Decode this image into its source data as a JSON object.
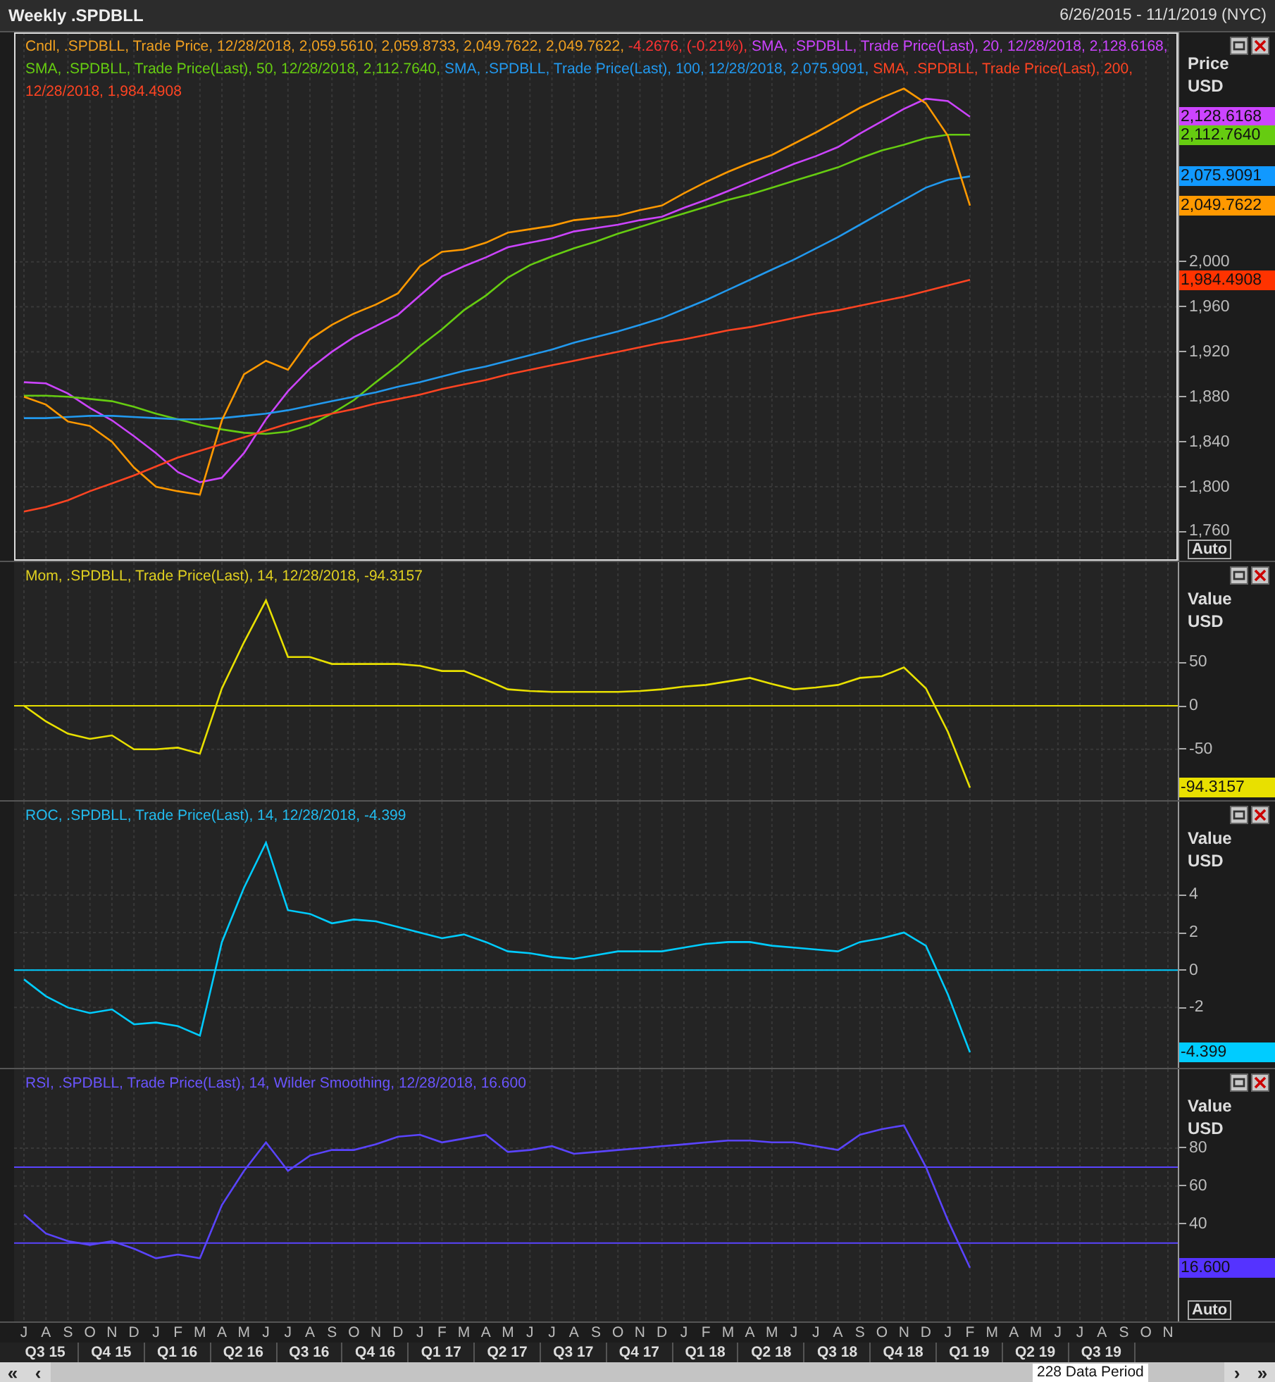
{
  "header": {
    "title": "Weekly .SPDBLL",
    "range": "6/26/2015 - 11/1/2019 (NYC)"
  },
  "panels": [
    {
      "axis_title": "Price",
      "axis_unit": "USD",
      "auto": "Auto",
      "legend": [
        {
          "text": "Cndl, .SPDBLL, Trade Price, 12/28/2018, 2,059.5610, 2,059.8733, 2,049.7622, 2,049.7622,",
          "color": "#f0a020"
        },
        {
          "text": " -4.2676, (-0.21%),",
          "color": "#ff3333"
        },
        {
          "text": " SMA, .SPDBLL, Trade Price(Last), 20, 12/28/2018, 2,128.6168,",
          "color": "#cc44ff"
        },
        {
          "text": " SMA, .SPDBLL, Trade Price(Last), 50, 12/28/2018, 2,112.7640,",
          "color": "#66cc11"
        },
        {
          "text": " SMA, .SPDBLL, Trade Price(Last), 100, 12/28/2018, 2,075.9091,",
          "color": "#2299ee"
        },
        {
          "text": " SMA, .SPDBLL, Trade Price(Last), 200, 12/28/2018, 1,984.4908",
          "color": "#ff4422"
        }
      ],
      "tags": [
        {
          "text": "2,128.6168",
          "color": "#cc44ff"
        },
        {
          "text": "2,112.7640",
          "color": "#66cc11"
        },
        {
          "text": "2,075.9091",
          "color": "#1199ff"
        },
        {
          "text": "2,049.7622",
          "color": "#ff9900"
        },
        {
          "text": "1,984.4908",
          "color": "#ff3300"
        }
      ],
      "chart_data": {
        "type": "line",
        "ylim": [
          1733,
          2204
        ],
        "categories": [
          null,
          null,
          null,
          null,
          null,
          null,
          null,
          null,
          null,
          null,
          null,
          null,
          null,
          null,
          null,
          null,
          null,
          null,
          null,
          null,
          null,
          null,
          null,
          null,
          null,
          null,
          null,
          null,
          null,
          null,
          null,
          null,
          null,
          null,
          null,
          null,
          null,
          null,
          null,
          null,
          null,
          null,
          null,
          null,
          null,
          null,
          null,
          null,
          null,
          null,
          null,
          null,
          null
        ],
        "yticks": [
          {
            "value": 1760,
            "label": "1,760"
          },
          {
            "value": 1800,
            "label": "1,800"
          },
          {
            "value": 1840,
            "label": "1,840"
          },
          {
            "value": 1880,
            "label": "1,880"
          },
          {
            "value": 1920,
            "label": "1,920"
          },
          {
            "value": 1960,
            "label": "1,960"
          },
          {
            "value": 2000,
            "label": "2,000"
          }
        ],
        "grid": true,
        "series": [
          {
            "color": "#cc44ff",
            "values": [
              1893,
              1892,
              1883,
              1870,
              1859,
              1845,
              1830,
              1813,
              1804,
              1808,
              1830,
              1860,
              1885,
              1905,
              1920,
              1933,
              1943,
              1953,
              1970,
              1987,
              1996,
              2004,
              2013,
              2017,
              2021,
              2027,
              2030,
              2033,
              2037,
              2040,
              2048,
              2055,
              2063,
              2071,
              2079,
              2087,
              2094,
              2102,
              2114,
              2125,
              2136,
              2145,
              2143,
              2129,
              null,
              null,
              null,
              null,
              null,
              null,
              null,
              null,
              null
            ]
          },
          {
            "color": "#66cc11",
            "values": [
              1881,
              1881,
              1880,
              1878,
              1876,
              1871,
              1865,
              1860,
              1855,
              1851,
              1848,
              1847,
              1849,
              1855,
              1865,
              1877,
              1893,
              1908,
              1925,
              1940,
              1957,
              1970,
              1986,
              1997,
              2005,
              2012,
              2018,
              2025,
              2031,
              2037,
              2043,
              2049,
              2055,
              2060,
              2066,
              2072,
              2078,
              2084,
              2092,
              2099,
              2104,
              2110,
              2113,
              2113,
              null,
              null,
              null,
              null,
              null,
              null,
              null,
              null,
              null
            ]
          },
          {
            "color": "#2299ee",
            "values": [
              1861,
              1861,
              1862,
              1863,
              1863,
              1862,
              1861,
              1860,
              1860,
              1861,
              1863,
              1865,
              1868,
              1872,
              1876,
              1880,
              1884,
              1889,
              1893,
              1898,
              1903,
              1907,
              1912,
              1917,
              1922,
              1928,
              1933,
              1938,
              1944,
              1950,
              1958,
              1966,
              1975,
              1984,
              1993,
              2002,
              2012,
              2022,
              2033,
              2044,
              2055,
              2066,
              2073,
              2076,
              null,
              null,
              null,
              null,
              null,
              null,
              null,
              null,
              null
            ]
          },
          {
            "color": "#ff9900",
            "values": [
              1880,
              1873,
              1858,
              1854,
              1840,
              1817,
              1800,
              1796,
              1793,
              1859,
              1900,
              1912,
              1904,
              1931,
              1944,
              1954,
              1962,
              1972,
              1996,
              2009,
              2011,
              2017,
              2026,
              2029,
              2032,
              2037,
              2039,
              2041,
              2046,
              2050,
              2061,
              2071,
              2080,
              2088,
              2095,
              2105,
              2115,
              2126,
              2137,
              2146,
              2154,
              2141,
              2112,
              2050,
              null,
              null,
              null,
              null,
              null,
              null,
              null,
              null,
              null
            ]
          },
          {
            "color": "#ff4422",
            "values": [
              1778,
              1782,
              1788,
              1796,
              1803,
              1810,
              1818,
              1826,
              1832,
              1838,
              1844,
              1850,
              1856,
              1861,
              1865,
              1869,
              1874,
              1878,
              1882,
              1887,
              1891,
              1895,
              1900,
              1904,
              1908,
              1912,
              1916,
              1920,
              1924,
              1928,
              1931,
              1935,
              1939,
              1942,
              1946,
              1950,
              1954,
              1957,
              1961,
              1965,
              1969,
              1974,
              1979,
              1984,
              null,
              null,
              null,
              null,
              null,
              null,
              null,
              null,
              null
            ]
          }
        ]
      }
    },
    {
      "axis_title": "Value",
      "axis_unit": "USD",
      "legend": [
        {
          "text": "Mom, .SPDBLL, Trade Price(Last), 14, 12/28/2018, -94.3157",
          "color": "#e0d020"
        }
      ],
      "tags": [
        {
          "text": "-94.3157",
          "color": "#e8e000"
        }
      ],
      "chart_data": {
        "type": "line",
        "ylim": [
          -110,
          165
        ],
        "categories": [
          null,
          null,
          null,
          null,
          null,
          null,
          null,
          null,
          null,
          null,
          null,
          null,
          null,
          null,
          null,
          null,
          null,
          null,
          null,
          null,
          null,
          null,
          null,
          null,
          null,
          null,
          null,
          null,
          null,
          null,
          null,
          null,
          null,
          null,
          null,
          null,
          null,
          null,
          null,
          null,
          null,
          null,
          null,
          null,
          null,
          null,
          null,
          null,
          null,
          null,
          null,
          null,
          null
        ],
        "yticks": [
          {
            "value": 50,
            "label": "50"
          },
          {
            "value": 0,
            "label": "0"
          },
          {
            "value": -50,
            "label": "-50"
          }
        ],
        "ref_lines": [
          {
            "axis": "y",
            "value": 0
          }
        ],
        "grid": true,
        "series": [
          {
            "color": "#e8e000",
            "values": [
              0,
              -18,
              -32,
              -38,
              -34,
              -50,
              -50,
              -48,
              -55,
              20,
              73,
              121,
              56,
              56,
              48,
              48,
              48,
              48,
              46,
              40,
              40,
              30,
              19,
              17,
              16,
              16,
              16,
              16,
              17,
              19,
              22,
              24,
              28,
              32,
              25,
              19,
              21,
              24,
              32,
              34,
              44,
              20,
              -30,
              -94,
              null,
              null,
              null,
              null,
              null,
              null,
              null,
              null,
              null
            ]
          }
        ]
      }
    },
    {
      "axis_title": "Value",
      "axis_unit": "USD",
      "legend": [
        {
          "text": "ROC, .SPDBLL, Trade Price(Last), 14, 12/28/2018, -4.399",
          "color": "#22bbee"
        }
      ],
      "tags": [
        {
          "text": "-4.399",
          "color": "#00ccff"
        }
      ],
      "chart_data": {
        "type": "line",
        "ylim": [
          -5.3,
          9
        ],
        "categories": [
          null,
          null,
          null,
          null,
          null,
          null,
          null,
          null,
          null,
          null,
          null,
          null,
          null,
          null,
          null,
          null,
          null,
          null,
          null,
          null,
          null,
          null,
          null,
          null,
          null,
          null,
          null,
          null,
          null,
          null,
          null,
          null,
          null,
          null,
          null,
          null,
          null,
          null,
          null,
          null,
          null,
          null,
          null,
          null,
          null,
          null,
          null,
          null,
          null,
          null,
          null,
          null,
          null
        ],
        "yticks": [
          {
            "value": 4,
            "label": "4"
          },
          {
            "value": 2,
            "label": "2"
          },
          {
            "value": 0,
            "label": "0"
          },
          {
            "value": -2,
            "label": "-2"
          }
        ],
        "ref_lines": [
          {
            "axis": "y",
            "value": 0
          }
        ],
        "grid": true,
        "series": [
          {
            "color": "#00ccff",
            "values": [
              -0.5,
              -1.4,
              -2,
              -2.3,
              -2.1,
              -2.9,
              -2.8,
              -3,
              -3.5,
              1.5,
              4.4,
              6.8,
              3.2,
              3,
              2.5,
              2.7,
              2.6,
              2.3,
              2,
              1.7,
              1.9,
              1.5,
              1,
              0.9,
              0.7,
              0.6,
              0.8,
              1,
              1,
              1,
              1.2,
              1.4,
              1.5,
              1.5,
              1.3,
              1.2,
              1.1,
              1,
              1.5,
              1.7,
              2,
              1.3,
              -1.3,
              -4.4,
              null,
              null,
              null,
              null,
              null,
              null,
              null,
              null,
              null
            ]
          }
        ]
      }
    },
    {
      "axis_title": "Value",
      "axis_unit": "USD",
      "auto": "Auto",
      "legend": [
        {
          "text": "RSI, .SPDBLL, Trade Price(Last), 14, Wilder Smoothing, 12/28/2018, 16.600",
          "color": "#6a55ff"
        }
      ],
      "tags": [
        {
          "text": "16.600",
          "color": "#5533ff"
        }
      ],
      "chart_data": {
        "type": "line",
        "ylim": [
          -12,
          121.5
        ],
        "categories": [
          "J",
          "A",
          "S",
          "O",
          "N",
          "D",
          "J",
          "F",
          "M",
          "A",
          "M",
          "J",
          "J",
          "A",
          "S",
          "O",
          "N",
          "D",
          "J",
          "F",
          "M",
          "A",
          "M",
          "J",
          "J",
          "A",
          "S",
          "O",
          "N",
          "D",
          "J",
          "F",
          "M",
          "A",
          "M",
          "J",
          "J",
          "A",
          "S",
          "O",
          "N",
          "D",
          "J",
          "F",
          "M",
          "A",
          "M",
          "J",
          "J",
          "A",
          "S",
          "O",
          "N"
        ],
        "yticks": [
          {
            "value": 80,
            "label": "80"
          },
          {
            "value": 60,
            "label": "60"
          },
          {
            "value": 40,
            "label": "40"
          }
        ],
        "ref_lines": [
          {
            "axis": "y",
            "value": 70
          },
          {
            "axis": "y",
            "value": 30
          }
        ],
        "grid": true,
        "series": [
          {
            "color": "#5a44ff",
            "values": [
              45,
              35,
              31,
              29,
              31,
              27,
              22,
              24,
              22,
              50,
              68,
              83,
              68,
              76,
              79,
              79,
              82,
              86,
              87,
              83,
              85,
              87,
              78,
              79,
              81,
              77,
              78,
              79,
              80,
              81,
              82,
              83,
              84,
              84,
              83,
              83,
              81,
              79,
              87,
              90,
              92,
              70,
              42,
              17,
              null,
              null,
              null,
              null,
              null,
              null,
              null,
              null,
              null
            ]
          }
        ]
      }
    }
  ],
  "x_axis": {
    "quarters": [
      "Q3 15",
      "Q4 15",
      "Q1 16",
      "Q2 16",
      "Q3 16",
      "Q4 16",
      "Q1 17",
      "Q2 17",
      "Q3 17",
      "Q4 17",
      "Q1 18",
      "Q2 18",
      "Q3 18",
      "Q4 18",
      "Q1 19",
      "Q2 19",
      "Q3 19"
    ]
  },
  "scrollbar": {
    "left": [
      "«",
      "‹"
    ],
    "label": "228 Data Period",
    "right": [
      "›",
      "»"
    ]
  }
}
